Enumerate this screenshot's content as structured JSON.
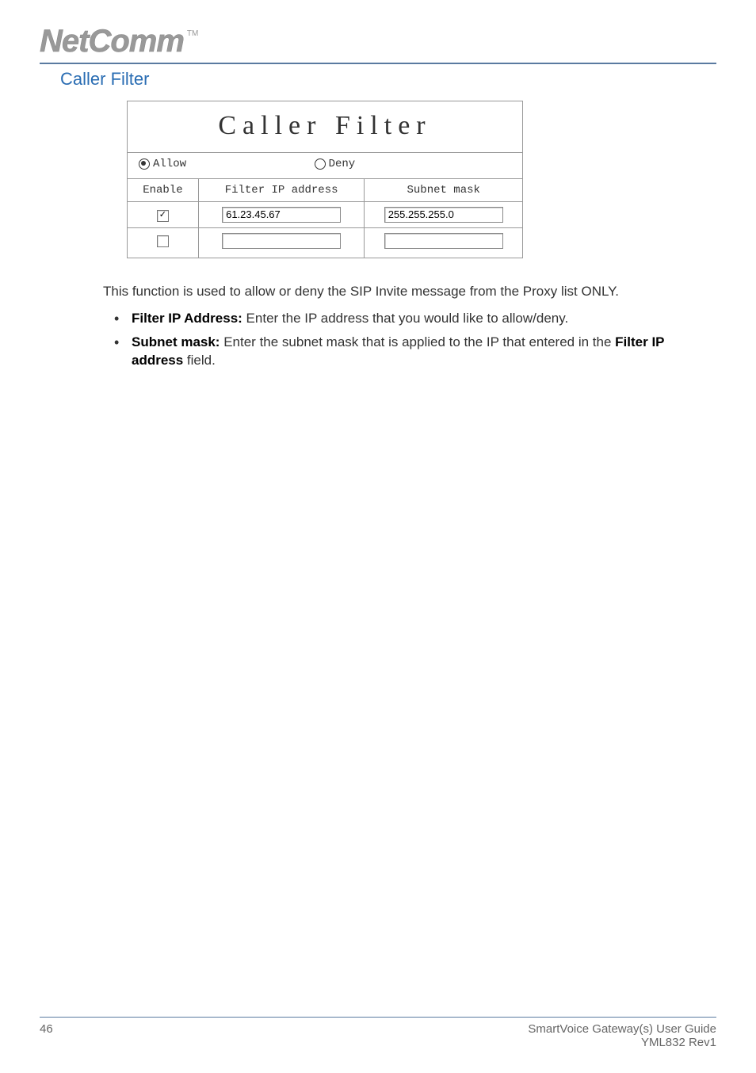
{
  "header": {
    "logo_text": "NetComm",
    "tm": "TM"
  },
  "section": {
    "title": "Caller Filter"
  },
  "panel": {
    "title": "Caller Filter",
    "mode": {
      "allow_label": "Allow",
      "deny_label": "Deny",
      "allow_checked": true,
      "deny_checked": false
    },
    "columns": {
      "enable": "Enable",
      "filter_ip": "Filter IP address",
      "subnet": "Subnet mask"
    },
    "rows": [
      {
        "enabled": true,
        "ip": "61.23.45.67",
        "mask": "255.255.255.0"
      },
      {
        "enabled": false,
        "ip": "",
        "mask": ""
      }
    ]
  },
  "body": {
    "intro": "This function is used to allow or deny the SIP Invite message from the Proxy list ONLY.",
    "items": [
      {
        "term": "Filter IP Address:",
        "desc": " Enter the IP address that you would like to allow/deny."
      },
      {
        "term": "Subnet mask:",
        "desc_pre": " Enter the subnet mask that is applied to the IP that entered in the ",
        "desc_bold": "Filter IP address",
        "desc_post": " field."
      }
    ]
  },
  "footer": {
    "page": "46",
    "guide": "SmartVoice Gateway(s) User Guide",
    "rev": "YML832 Rev1"
  }
}
